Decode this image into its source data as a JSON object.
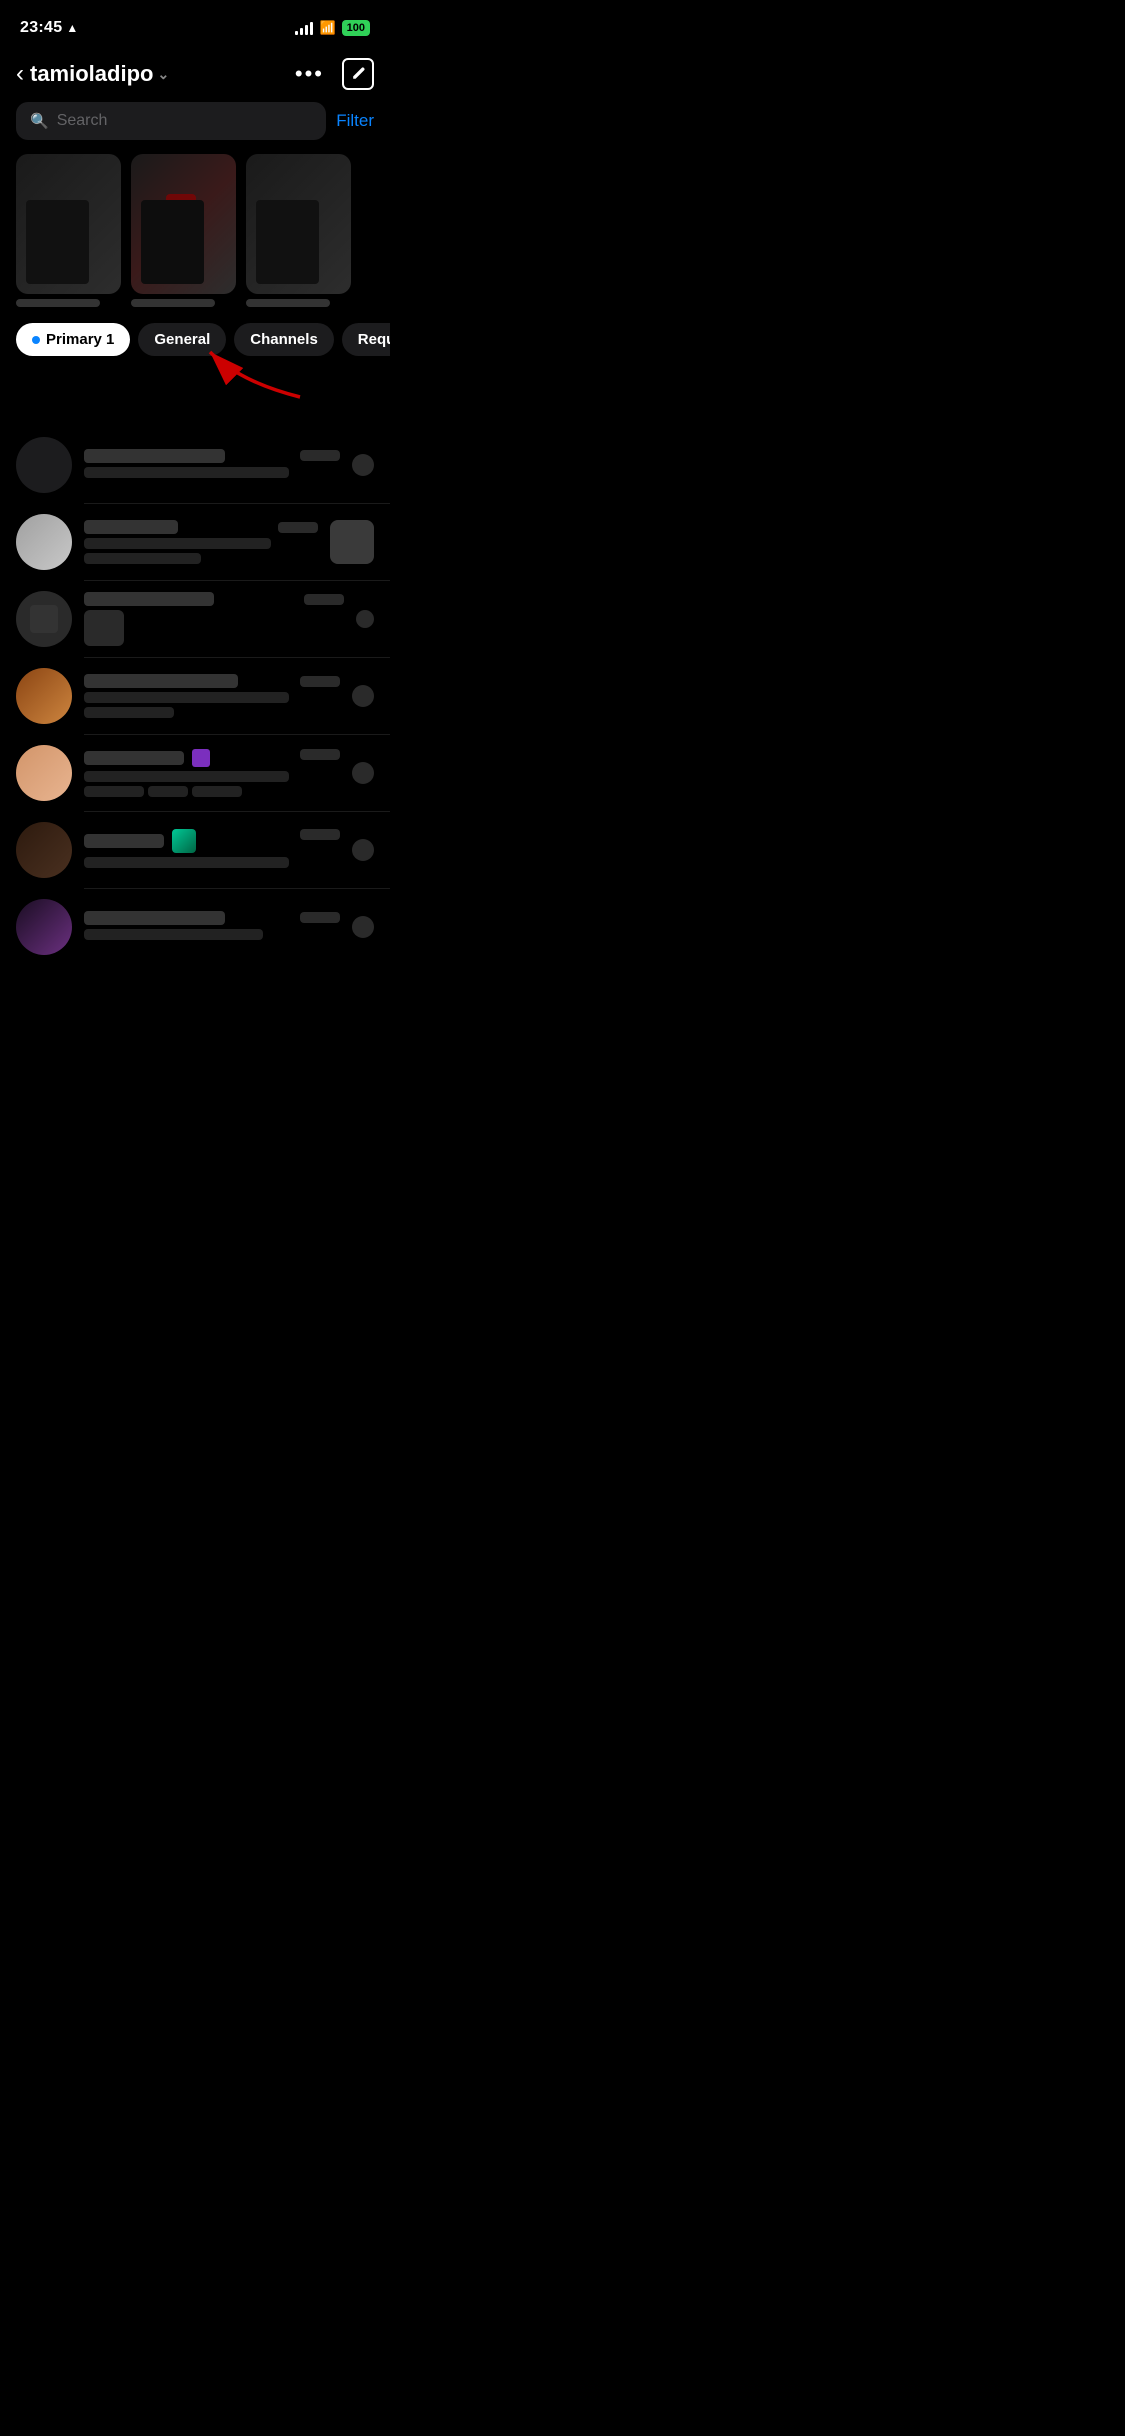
{
  "status": {
    "time": "23:45",
    "battery": "100",
    "nav_arrow": "›"
  },
  "header": {
    "back_label": "‹",
    "title": "tamioladipo",
    "chevron": "⌄",
    "more_label": "•••",
    "compose_label": "✏"
  },
  "search": {
    "placeholder": "Search",
    "filter_label": "Filter"
  },
  "tabs": {
    "primary": "Primary 1",
    "general": "General",
    "channels": "Channels",
    "requests": "Requests"
  },
  "conversations": [
    {
      "id": 1,
      "avatar_class": "avatar-dark"
    },
    {
      "id": 2,
      "avatar_class": "avatar-gray"
    },
    {
      "id": 3,
      "avatar_class": "avatar-dark2"
    },
    {
      "id": 4,
      "avatar_class": "avatar-brown"
    },
    {
      "id": 5,
      "avatar_class": "avatar-peach"
    },
    {
      "id": 6,
      "avatar_class": "avatar-dark3"
    },
    {
      "id": 7,
      "avatar_class": "avatar-bw"
    }
  ]
}
